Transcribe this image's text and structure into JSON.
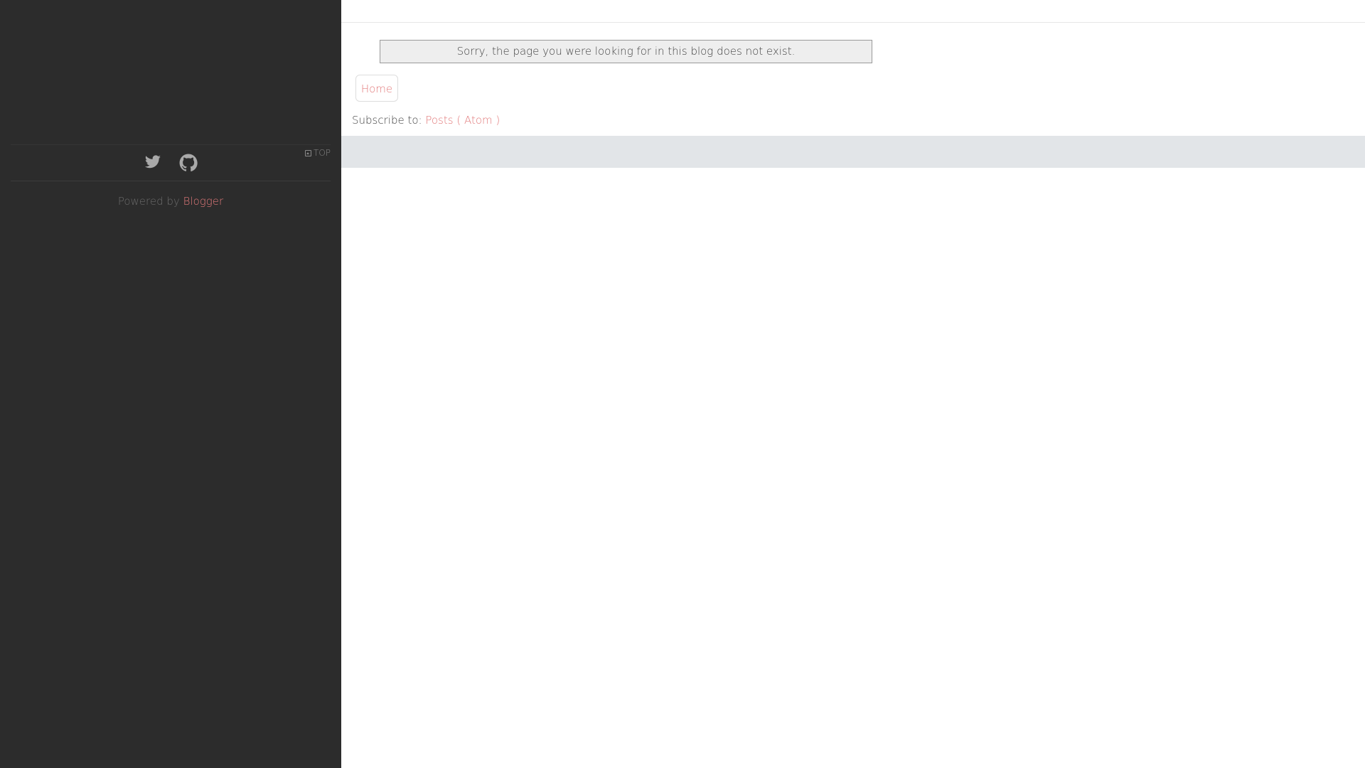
{
  "sidebar": {
    "top_link_label": "TOP",
    "social": [
      {
        "icon": "twitter-icon"
      },
      {
        "icon": "github-icon"
      }
    ],
    "powered_by_prefix": "Powered by",
    "powered_by_link": "Blogger"
  },
  "main": {
    "error_message": "Sorry, the page you were looking for in this blog does not exist.",
    "home_label": "Home",
    "subscribe_prefix": "Subscribe to:",
    "subscribe_link": "Posts ( Atom )"
  },
  "colors": {
    "sidebar_bg": "#2c2c2c",
    "accent": "#e2797a",
    "band": "#e2e5e8"
  }
}
